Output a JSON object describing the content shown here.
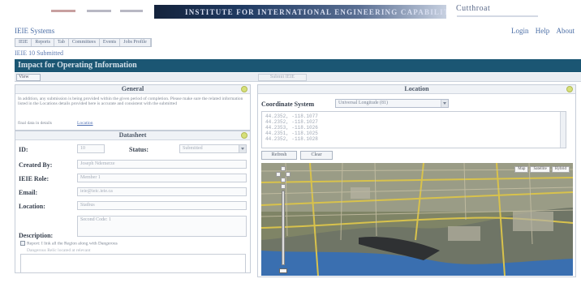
{
  "banner": {
    "title": "INSTITUTE FOR INTERNATIONAL ENGINEERING CAPABILITY",
    "right_text": "Cutthroat",
    "logo_marks": [
      "red-logo",
      "grey-logo",
      "grey-logo"
    ]
  },
  "app": {
    "title": "IEIE Systems",
    "links": [
      "Login",
      "Help",
      "About"
    ],
    "tabs": [
      "IEIE",
      "Reports",
      "Tab",
      "Committees",
      "Events",
      "Jobs Profile"
    ],
    "breadcrumb": "IEIE 10 Submitted"
  },
  "section": {
    "title": "Impact for Operating Information",
    "view_label": "View",
    "dim_button": "Submit IEIE"
  },
  "general": {
    "heading": "General",
    "body": "In addition, any submission is being provided within the given period of completion. Please make sure the related information listed in the Locations details provided here is accurate and consistent with the submitted",
    "tail_text": "final data in details",
    "link": "Location"
  },
  "details": {
    "heading": "Datasheet",
    "id_label": "ID:",
    "id_value": "10",
    "status_label": "Status:",
    "status_value": "Submitted",
    "created_by_label": "Created By:",
    "created_by_value": "Joseph Ndemerze",
    "ieie_role_label": "IEIE Role:",
    "ieie_role_value": "Member 1",
    "email_label": "Email:",
    "email_value": "ieie@ieic.ieie.ca",
    "location_label": "Location:",
    "location_value": "Statbus",
    "location_sub_value": "Second Code: 1",
    "description_label": "Description:",
    "checkbox_text": "Report: I link all the Region along with Dangerous",
    "checkbox_sub": "Dangerous Relic located at relevant"
  },
  "location": {
    "heading": "Location",
    "coord_label": "Coordinate System",
    "coord_value": "Universal Longitude (81)",
    "coords": [
      "44.2352, -118.1077",
      "44.2352, -118.1027",
      "44.2353, -118.1026",
      "44.2351, -118.1025",
      "44.2352, -118.1028"
    ],
    "buttons": [
      "Refresh",
      "Clear"
    ],
    "map_types": [
      "Map",
      "Satellite",
      "Hybrid"
    ]
  },
  "colors": {
    "section_bar": "#1b5673",
    "link_blue": "#4b6ea6",
    "map_water": "#3a6fb0",
    "map_road": "#d8c24c"
  }
}
